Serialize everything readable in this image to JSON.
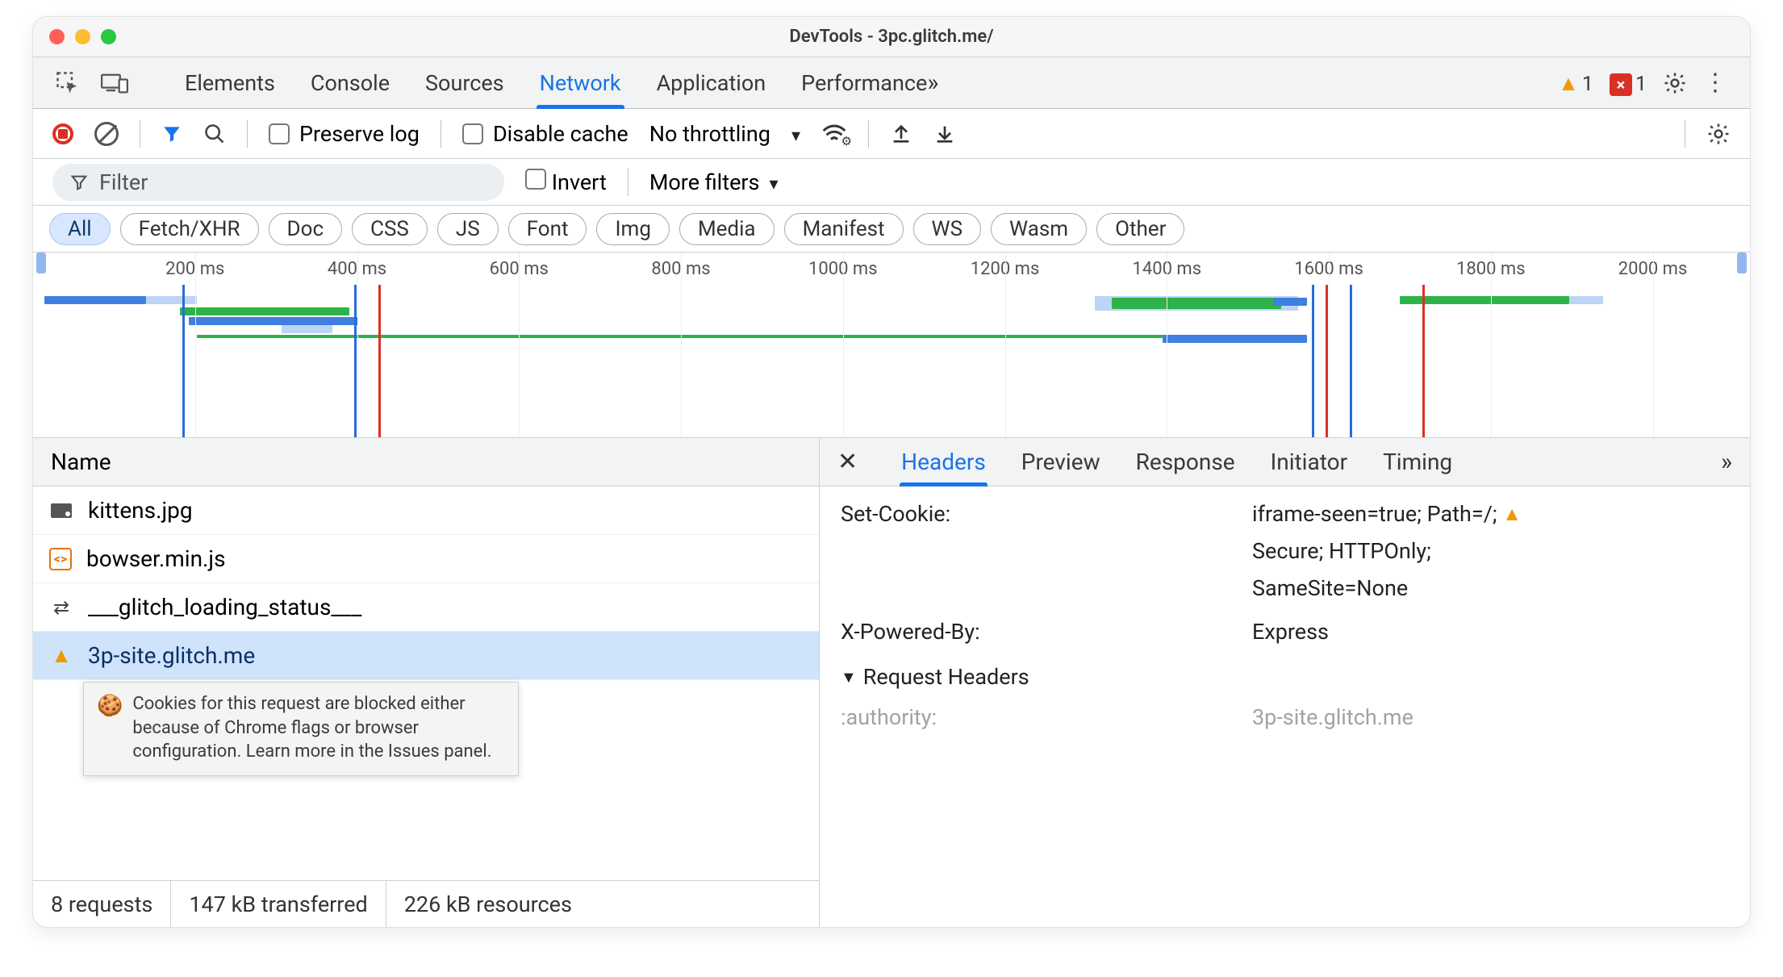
{
  "window": {
    "title": "DevTools - 3pc.glitch.me/"
  },
  "tabs": {
    "items": [
      "Elements",
      "Console",
      "Sources",
      "Network",
      "Application",
      "Performance"
    ],
    "active": "Network",
    "warnings_count": "1",
    "errors_count": "1"
  },
  "network_toolbar": {
    "preserve_log": "Preserve log",
    "disable_cache": "Disable cache",
    "throttling": "No throttling"
  },
  "filter_row": {
    "placeholder": "Filter",
    "invert": "Invert",
    "more_filters": "More filters"
  },
  "type_chips": [
    "All",
    "Fetch/XHR",
    "Doc",
    "CSS",
    "JS",
    "Font",
    "Img",
    "Media",
    "Manifest",
    "WS",
    "Wasm",
    "Other"
  ],
  "type_chip_active": "All",
  "timeline": {
    "ticks": [
      "200 ms",
      "400 ms",
      "600 ms",
      "800 ms",
      "1000 ms",
      "1200 ms",
      "1400 ms",
      "1600 ms",
      "1800 ms",
      "2000 ms"
    ]
  },
  "request_list": {
    "column": "Name",
    "rows": [
      {
        "icon": "image",
        "name": "kittens.jpg"
      },
      {
        "icon": "js",
        "name": "bowser.min.js"
      },
      {
        "icon": "ws",
        "name": "___glitch_loading_status___"
      },
      {
        "icon": "warn",
        "name": "3p-site.glitch.me",
        "selected": true
      }
    ],
    "tooltip": "Cookies for this request are blocked either because of Chrome flags or browser configuration. Learn more in the Issues panel.",
    "status": {
      "requests": "8 requests",
      "transferred": "147 kB transferred",
      "resources": "226 kB resources"
    }
  },
  "detail": {
    "tabs": [
      "Headers",
      "Preview",
      "Response",
      "Initiator",
      "Timing"
    ],
    "active": "Headers",
    "response_headers": [
      {
        "key": "Set-Cookie:",
        "values": [
          "iframe-seen=true; Path=/;",
          "Secure; HTTPOnly;",
          "SameSite=None"
        ],
        "warn": true
      },
      {
        "key": "X-Powered-By:",
        "values": [
          "Express"
        ]
      }
    ],
    "request_headers_title": "Request Headers",
    "request_headers_peek": {
      "key": ":authority:",
      "value": "3p-site.glitch.me"
    }
  }
}
